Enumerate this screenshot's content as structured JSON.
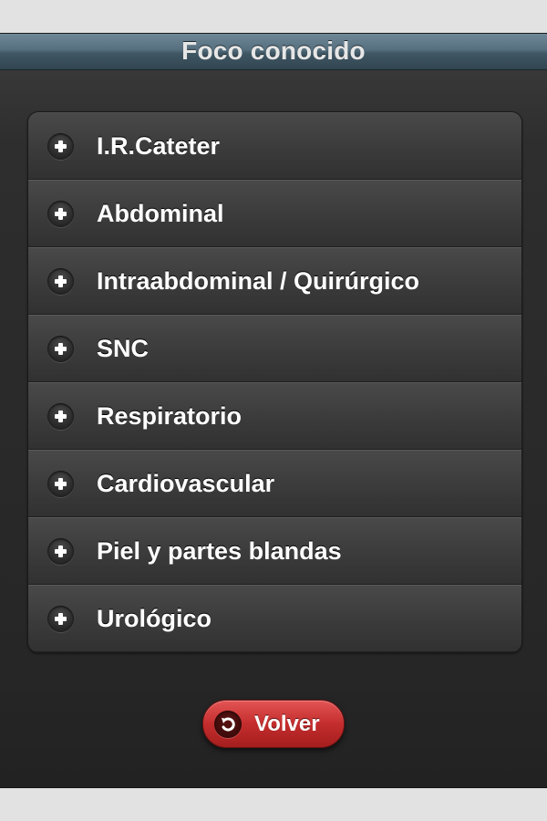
{
  "header": {
    "title": "Foco conocido"
  },
  "list": {
    "items": [
      {
        "label": "I.R.Cateter",
        "icon": "plus-icon"
      },
      {
        "label": "Abdominal",
        "icon": "plus-icon"
      },
      {
        "label": "Intraabdominal / Quirúrgico",
        "icon": "plus-icon"
      },
      {
        "label": "SNC",
        "icon": "plus-icon"
      },
      {
        "label": "Respiratorio",
        "icon": "plus-icon"
      },
      {
        "label": "Cardiovascular",
        "icon": "plus-icon"
      },
      {
        "label": "Piel y partes blandas",
        "icon": "plus-icon"
      },
      {
        "label": "Urológico",
        "icon": "plus-icon"
      }
    ]
  },
  "footer": {
    "back_label": "Volver",
    "back_icon": "back-arrow-icon"
  },
  "colors": {
    "header": "#4f6776",
    "background": "#2b2b2b",
    "button": "#c42d2d"
  }
}
